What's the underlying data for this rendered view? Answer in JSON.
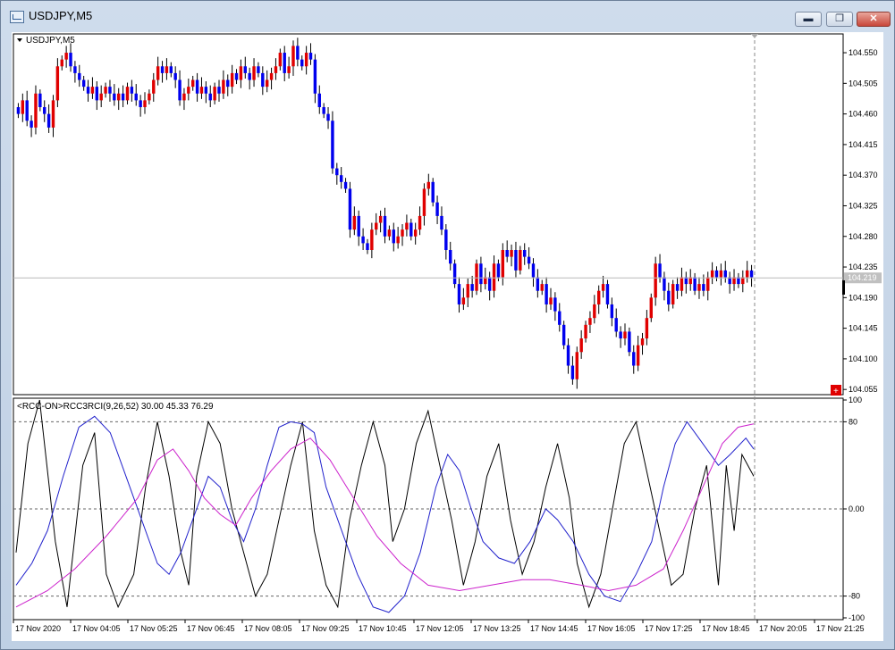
{
  "window": {
    "title": "USDJPY,M5",
    "buttons": {
      "minimize": "▬",
      "restore": "❐",
      "close": "✕"
    }
  },
  "main_chart": {
    "label": "USDJPY,M5",
    "current_price_label": "104.219",
    "price_axis_labels": [
      "104.550",
      "104.505",
      "104.460",
      "104.415",
      "104.370",
      "104.325",
      "104.280",
      "104.235",
      "104.190",
      "104.145",
      "104.100",
      "104.055"
    ]
  },
  "indicator": {
    "label": "<RCC-ON>RCC3RCI(9,26,52) 30.00 45.33 76.29",
    "axis_labels": [
      "100",
      "80",
      "0.00",
      "-80",
      "-100"
    ]
  },
  "time_axis_labels": [
    "17 Nov 2020",
    "17 Nov 04:05",
    "17 Nov 05:25",
    "17 Nov 06:45",
    "17 Nov 08:05",
    "17 Nov 09:25",
    "17 Nov 10:45",
    "17 Nov 12:05",
    "17 Nov 13:25",
    "17 Nov 14:45",
    "17 Nov 16:05",
    "17 Nov 17:25",
    "17 Nov 18:45",
    "17 Nov 20:05",
    "17 Nov 21:25"
  ],
  "colors": {
    "bull": "#e00000",
    "bear": "#0000ee",
    "rci_short": "#000000",
    "rci_mid": "#2222cc",
    "rci_long": "#cc22cc",
    "current_price_bg": "#c0c0c0"
  },
  "chart_data": [
    {
      "type": "candlestick",
      "title": "USDJPY,M5",
      "xlabel": "",
      "ylabel": "",
      "ylim": [
        104.05,
        104.575
      ],
      "closes": [
        104.46,
        104.48,
        104.45,
        104.44,
        104.49,
        104.47,
        104.46,
        104.44,
        104.48,
        104.53,
        104.54,
        104.55,
        104.53,
        104.52,
        104.51,
        104.5,
        104.49,
        104.5,
        104.48,
        104.49,
        104.5,
        104.49,
        104.48,
        104.49,
        104.48,
        104.5,
        104.49,
        104.48,
        104.47,
        104.48,
        104.49,
        104.51,
        104.53,
        104.52,
        104.53,
        104.52,
        104.51,
        104.48,
        104.49,
        104.5,
        104.51,
        104.49,
        104.5,
        104.49,
        104.48,
        104.5,
        104.49,
        104.51,
        104.5,
        104.52,
        104.51,
        104.53,
        104.52,
        104.51,
        104.53,
        104.52,
        104.5,
        104.51,
        104.52,
        104.53,
        104.55,
        104.52,
        104.53,
        104.56,
        104.54,
        104.53,
        104.55,
        104.54,
        104.49,
        104.47,
        104.46,
        104.45,
        104.38,
        104.37,
        104.36,
        104.35,
        104.29,
        104.31,
        104.28,
        104.27,
        104.26,
        104.29,
        104.3,
        104.31,
        104.28,
        104.29,
        104.27,
        104.28,
        104.29,
        104.3,
        104.28,
        104.29,
        104.31,
        104.35,
        104.36,
        104.33,
        104.31,
        104.29,
        104.26,
        104.24,
        104.21,
        104.18,
        104.19,
        104.21,
        104.2,
        104.24,
        104.21,
        104.22,
        104.2,
        104.24,
        104.22,
        104.26,
        104.25,
        104.26,
        104.23,
        104.26,
        104.25,
        104.24,
        104.22,
        104.2,
        104.21,
        104.18,
        104.19,
        104.17,
        104.15,
        104.12,
        104.09,
        104.07,
        104.11,
        104.13,
        104.15,
        104.16,
        104.18,
        104.2,
        104.21,
        104.18,
        104.16,
        104.14,
        104.13,
        104.14,
        104.11,
        104.09,
        104.12,
        104.13,
        104.16,
        104.19,
        104.24,
        104.22,
        104.2,
        104.18,
        104.21,
        104.2,
        104.22,
        104.21,
        104.22,
        104.2,
        104.21,
        104.2,
        104.22,
        104.23,
        104.22,
        104.23,
        104.22,
        104.21,
        104.22,
        104.21,
        104.22,
        104.23,
        104.22
      ]
    },
    {
      "type": "line",
      "title": "<RCC-ON>RCC3RCI(9,26,52) 30.00 45.33 76.29",
      "xlabel": "",
      "ylabel": "",
      "ylim": [
        -100,
        100
      ],
      "gridlines": [
        80,
        0,
        -80
      ],
      "series": [
        {
          "points": [
            [
              0,
              -40
            ],
            [
              6,
              60
            ],
            [
              12,
              100
            ],
            [
              20,
              -30
            ],
            [
              26,
              -90
            ],
            [
              34,
              40
            ],
            [
              40,
              70
            ],
            [
              46,
              -60
            ],
            [
              52,
              -90
            ],
            [
              60,
              -60
            ],
            [
              66,
              20
            ],
            [
              72,
              80
            ],
            [
              78,
              30
            ],
            [
              84,
              -40
            ],
            [
              88,
              -70
            ],
            [
              92,
              30
            ],
            [
              98,
              80
            ],
            [
              104,
              60
            ],
            [
              110,
              0
            ],
            [
              116,
              -40
            ],
            [
              122,
              -80
            ],
            [
              128,
              -60
            ],
            [
              134,
              -10
            ],
            [
              140,
              40
            ],
            [
              146,
              80
            ],
            [
              152,
              -20
            ],
            [
              158,
              -70
            ],
            [
              164,
              -90
            ],
            [
              170,
              -10
            ],
            [
              176,
              40
            ],
            [
              182,
              80
            ],
            [
              188,
              40
            ],
            [
              192,
              -30
            ],
            [
              198,
              0
            ],
            [
              204,
              60
            ],
            [
              210,
              90
            ],
            [
              216,
              40
            ],
            [
              222,
              -10
            ],
            [
              228,
              -70
            ],
            [
              234,
              -30
            ],
            [
              240,
              30
            ],
            [
              246,
              60
            ],
            [
              252,
              -10
            ],
            [
              258,
              -60
            ],
            [
              264,
              -30
            ],
            [
              270,
              20
            ],
            [
              276,
              60
            ],
            [
              282,
              10
            ],
            [
              286,
              -50
            ],
            [
              292,
              -90
            ],
            [
              298,
              -60
            ],
            [
              304,
              0
            ],
            [
              310,
              60
            ],
            [
              316,
              80
            ],
            [
              322,
              30
            ],
            [
              328,
              -20
            ],
            [
              334,
              -70
            ],
            [
              340,
              -60
            ],
            [
              346,
              0
            ],
            [
              352,
              40
            ],
            [
              358,
              -70
            ],
            [
              362,
              40
            ],
            [
              366,
              -20
            ],
            [
              370,
              50
            ],
            [
              376,
              30
            ]
          ]
        },
        {
          "points": [
            [
              0,
              -70
            ],
            [
              8,
              -50
            ],
            [
              16,
              -20
            ],
            [
              24,
              30
            ],
            [
              32,
              75
            ],
            [
              40,
              85
            ],
            [
              48,
              70
            ],
            [
              56,
              30
            ],
            [
              64,
              -10
            ],
            [
              72,
              -50
            ],
            [
              78,
              -60
            ],
            [
              84,
              -40
            ],
            [
              92,
              0
            ],
            [
              98,
              30
            ],
            [
              104,
              20
            ],
            [
              110,
              -10
            ],
            [
              116,
              -30
            ],
            [
              122,
              0
            ],
            [
              128,
              40
            ],
            [
              134,
              75
            ],
            [
              140,
              80
            ],
            [
              146,
              78
            ],
            [
              152,
              70
            ],
            [
              158,
              20
            ],
            [
              166,
              -20
            ],
            [
              174,
              -60
            ],
            [
              182,
              -90
            ],
            [
              190,
              -95
            ],
            [
              198,
              -80
            ],
            [
              206,
              -40
            ],
            [
              214,
              20
            ],
            [
              220,
              50
            ],
            [
              226,
              35
            ],
            [
              232,
              0
            ],
            [
              238,
              -30
            ],
            [
              246,
              -45
            ],
            [
              254,
              -50
            ],
            [
              262,
              -30
            ],
            [
              270,
              0
            ],
            [
              276,
              -10
            ],
            [
              284,
              -30
            ],
            [
              292,
              -60
            ],
            [
              300,
              -80
            ],
            [
              308,
              -85
            ],
            [
              316,
              -60
            ],
            [
              324,
              -30
            ],
            [
              330,
              20
            ],
            [
              336,
              60
            ],
            [
              342,
              80
            ],
            [
              350,
              60
            ],
            [
              358,
              40
            ],
            [
              364,
              50
            ],
            [
              372,
              65
            ],
            [
              376,
              55
            ]
          ]
        },
        {
          "points": [
            [
              0,
              -90
            ],
            [
              16,
              -75
            ],
            [
              30,
              -55
            ],
            [
              46,
              -25
            ],
            [
              62,
              10
            ],
            [
              72,
              45
            ],
            [
              80,
              55
            ],
            [
              88,
              35
            ],
            [
              96,
              10
            ],
            [
              104,
              -5
            ],
            [
              112,
              -15
            ],
            [
              120,
              10
            ],
            [
              130,
              35
            ],
            [
              140,
              55
            ],
            [
              150,
              65
            ],
            [
              160,
              45
            ],
            [
              172,
              10
            ],
            [
              184,
              -25
            ],
            [
              196,
              -50
            ],
            [
              210,
              -70
            ],
            [
              226,
              -75
            ],
            [
              242,
              -70
            ],
            [
              258,
              -65
            ],
            [
              272,
              -65
            ],
            [
              288,
              -70
            ],
            [
              302,
              -75
            ],
            [
              316,
              -70
            ],
            [
              330,
              -55
            ],
            [
              340,
              -20
            ],
            [
              350,
              20
            ],
            [
              360,
              60
            ],
            [
              368,
              75
            ],
            [
              376,
              78
            ]
          ]
        }
      ]
    }
  ]
}
